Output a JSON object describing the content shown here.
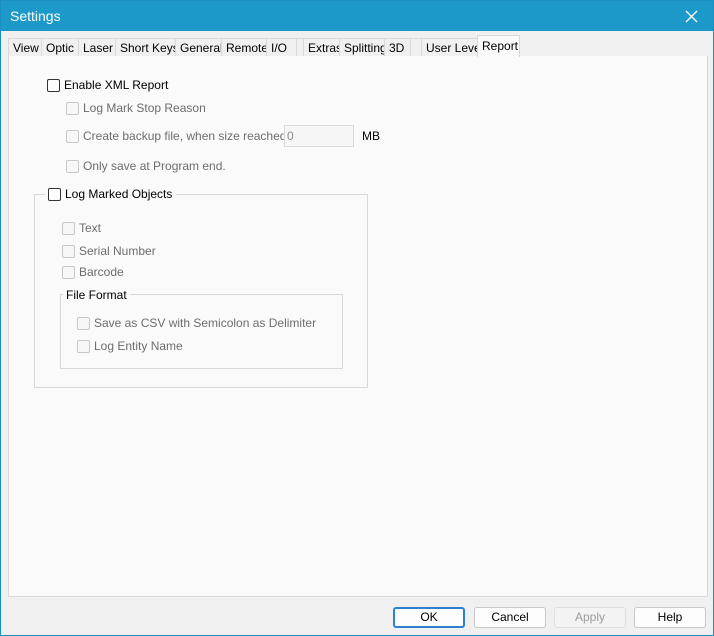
{
  "window": {
    "title": "Settings"
  },
  "tabs": [
    {
      "label": "View"
    },
    {
      "label": "Optic"
    },
    {
      "label": "Laser"
    },
    {
      "label": "Short Keys"
    },
    {
      "label": "General"
    },
    {
      "label": "Remote"
    },
    {
      "label": "I/O"
    },
    {
      "label": ""
    },
    {
      "label": "Extras"
    },
    {
      "label": "Splitting"
    },
    {
      "label": "3D"
    },
    {
      "label": ""
    },
    {
      "label": "User Level"
    },
    {
      "label": "Report"
    }
  ],
  "active_tab": "Report",
  "report": {
    "enable_xml": {
      "label": "Enable XML Report",
      "checked": false
    },
    "log_mark_stop": {
      "label": "Log Mark Stop Reason",
      "checked": false,
      "enabled": false
    },
    "backup": {
      "label": "Create backup file, when size reached:",
      "checked": false,
      "enabled": false,
      "value": "0",
      "unit": "MB"
    },
    "only_save_end": {
      "label": "Only save at Program end.",
      "checked": false,
      "enabled": false
    },
    "log_marked_objects": {
      "label": "Log Marked Objects",
      "checked": false,
      "text": {
        "label": "Text",
        "checked": false,
        "enabled": false
      },
      "serial": {
        "label": "Serial Number",
        "checked": false,
        "enabled": false
      },
      "barcode": {
        "label": "Barcode",
        "checked": false,
        "enabled": false
      },
      "file_format": {
        "title": "File Format",
        "csv": {
          "label": "Save as CSV with Semicolon as Delimiter",
          "checked": false,
          "enabled": false
        },
        "entity": {
          "label": "Log Entity Name",
          "checked": false,
          "enabled": false
        }
      }
    }
  },
  "buttons": {
    "ok": {
      "label": "OK"
    },
    "cancel": {
      "label": "Cancel"
    },
    "apply": {
      "label": "Apply",
      "enabled": false
    },
    "help": {
      "label": "Help"
    }
  },
  "colors": {
    "titlebar": "#1c99c8",
    "accent": "#2d7fd0"
  }
}
